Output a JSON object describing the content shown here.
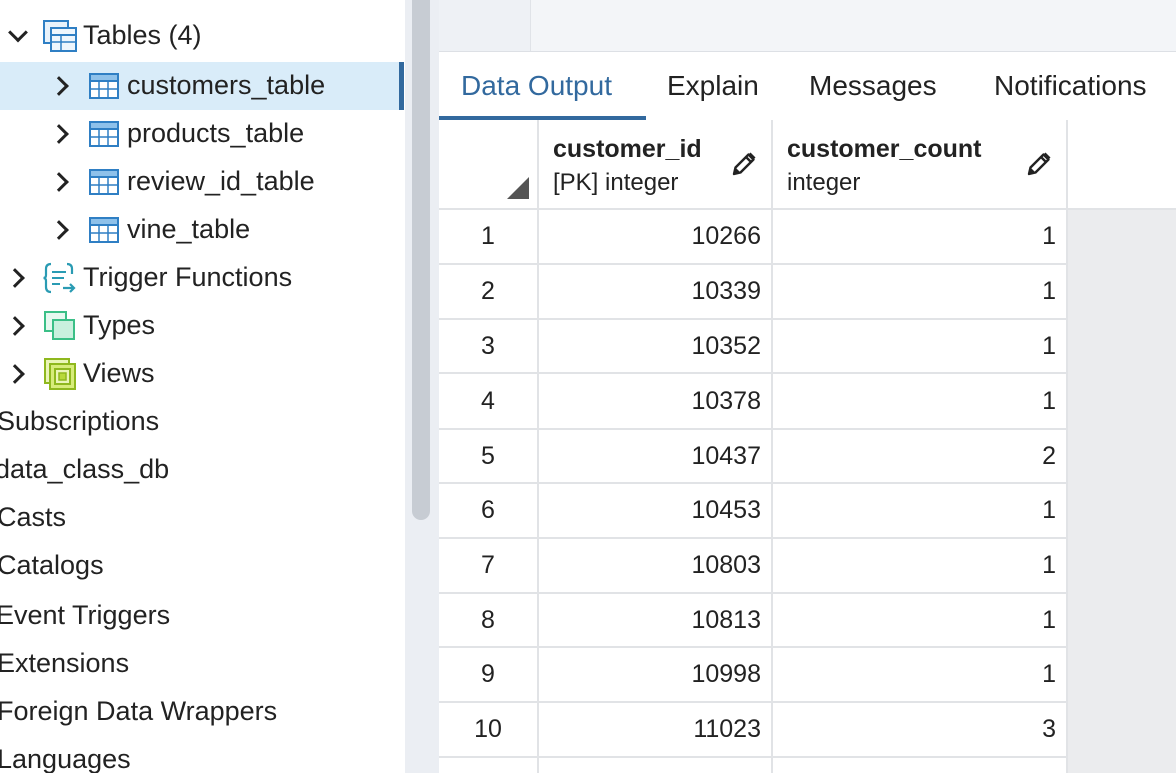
{
  "tree": {
    "items": [
      {
        "label": "Tables (4)",
        "expanded": true,
        "icon": "table-group-icon"
      },
      {
        "label": "customers_table",
        "selected": true,
        "icon": "table-icon"
      },
      {
        "label": "products_table",
        "icon": "table-icon"
      },
      {
        "label": "review_id_table",
        "icon": "table-icon"
      },
      {
        "label": "vine_table",
        "icon": "table-icon"
      },
      {
        "label": "Trigger Functions",
        "icon": "trigger-function-icon"
      },
      {
        "label": "Types",
        "icon": "types-icon"
      },
      {
        "label": "Views",
        "icon": "views-icon"
      },
      {
        "label": "Subscriptions"
      },
      {
        "label": "data_class_db"
      },
      {
        "label": "Casts"
      },
      {
        "label": "Catalogs"
      },
      {
        "label": "Event Triggers"
      },
      {
        "label": "Extensions"
      },
      {
        "label": "Foreign Data Wrappers"
      },
      {
        "label": "Languages"
      }
    ]
  },
  "tabs": [
    {
      "label": "Data Output",
      "active": true
    },
    {
      "label": "Explain"
    },
    {
      "label": "Messages"
    },
    {
      "label": "Notifications"
    }
  ],
  "grid": {
    "columns": [
      {
        "name": "customer_id",
        "type": "[PK] integer"
      },
      {
        "name": "customer_count",
        "type": "integer"
      }
    ],
    "rows": [
      {
        "n": "1",
        "customer_id": "10266",
        "customer_count": "1"
      },
      {
        "n": "2",
        "customer_id": "10339",
        "customer_count": "1"
      },
      {
        "n": "3",
        "customer_id": "10352",
        "customer_count": "1"
      },
      {
        "n": "4",
        "customer_id": "10378",
        "customer_count": "1"
      },
      {
        "n": "5",
        "customer_id": "10437",
        "customer_count": "2"
      },
      {
        "n": "6",
        "customer_id": "10453",
        "customer_count": "1"
      },
      {
        "n": "7",
        "customer_id": "10803",
        "customer_count": "1"
      },
      {
        "n": "8",
        "customer_id": "10813",
        "customer_count": "1"
      },
      {
        "n": "9",
        "customer_id": "10998",
        "customer_count": "1"
      },
      {
        "n": "10",
        "customer_id": "11023",
        "customer_count": "3"
      }
    ]
  },
  "colors": {
    "accent": "#32699e",
    "selected_bg": "#d9ecf9"
  }
}
